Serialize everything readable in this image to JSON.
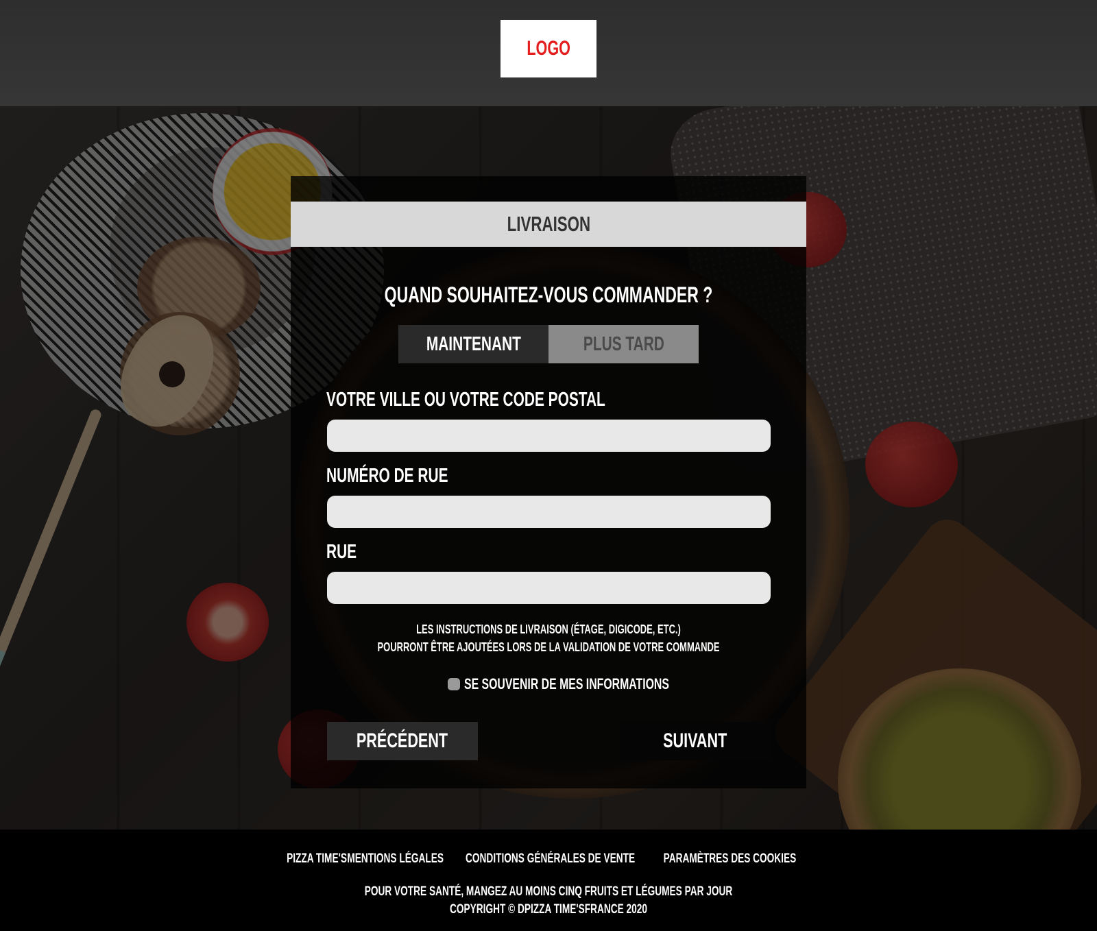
{
  "header": {
    "logo_text": "LOGO"
  },
  "card": {
    "title": "LIVRAISON",
    "question": "QUAND SOUHAITEZ-VOUS COMMANDER ?",
    "toggle": {
      "now_label": "MAINTENANT",
      "later_label": "PLUS TARD",
      "selected": "MAINTENANT"
    },
    "fields": {
      "city_label": "VOTRE VILLE OU VOTRE CODE POSTAL",
      "city_value": "",
      "street_number_label": "NUMÉRO DE RUE",
      "street_number_value": "",
      "street_label": "RUE",
      "street_value": ""
    },
    "note_line1": "LES INSTRUCTIONS DE LIVRAISON (ÉTAGE, DIGICODE, ETC.)",
    "note_line2": "POURRONT ÊTRE AJOUTÉES LORS DE LA VALIDATION DE VOTRE COMMANDE",
    "remember_label": "SE SOUVENIR DE MES INFORMATIONS",
    "prev_label": "PRÉCÉDENT",
    "next_label": "SUIVANT"
  },
  "footer": {
    "links": [
      "PIZZA TIME'S",
      "MENTIONS LÉGALES",
      "CONDITIONS GÉNÉRALES DE VENTE",
      "PARAMÈTRES DES COOKIES"
    ],
    "health_message": "POUR VOTRE SANTÉ, MANGEZ AU MOINS CINQ FRUITS ET LÉGUMES PAR JOUR",
    "copyright": "COPYRIGHT © DPIZZA TIME'SFRANCE 2020"
  },
  "colors": {
    "logo_red": "#e41e1e",
    "title_bar": "#d8d8d8",
    "input_bg": "#e8e8e8",
    "active_toggle": "#2a2a2a",
    "inactive_toggle": "#8a8a8a"
  }
}
